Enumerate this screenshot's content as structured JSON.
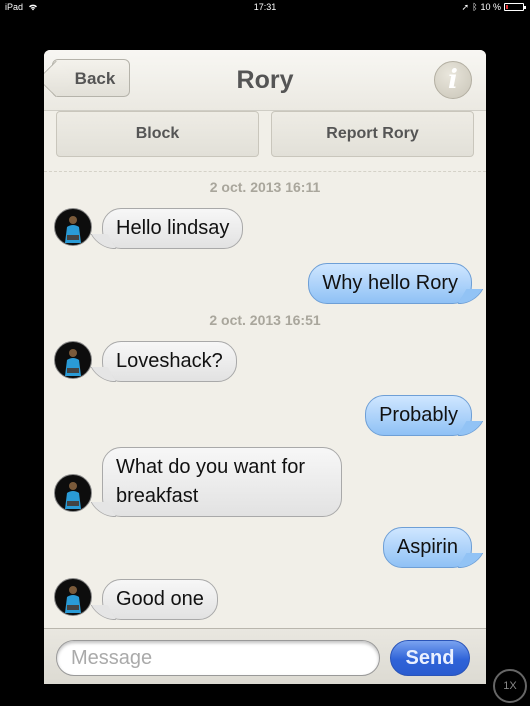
{
  "status_bar": {
    "device": "iPad",
    "wifi_icon": "wifi-icon",
    "time": "17:31",
    "battery_text": "10 %",
    "battery_level": 0.1,
    "battery_color": "#e33333"
  },
  "nav": {
    "back_label": "Back",
    "title": "Rory",
    "info_icon": "info-icon"
  },
  "actions": {
    "block_label": "Block",
    "report_label": "Report Rory"
  },
  "conversation": {
    "timestamp_1": "2 oct. 2013 16:11",
    "timestamp_2": "2 oct. 2013 16:51",
    "messages": [
      {
        "from": "Rory",
        "text": "Hello lindsay"
      },
      {
        "from": "me",
        "text": "Why hello Rory"
      },
      {
        "from": "Rory",
        "text": "Loveshack?"
      },
      {
        "from": "me",
        "text": "Probably"
      },
      {
        "from": "Rory",
        "text": "What do you want for breakfast"
      },
      {
        "from": "me",
        "text": "Aspirin"
      },
      {
        "from": "Rory",
        "text": "Good one"
      }
    ]
  },
  "composer": {
    "placeholder": "Message",
    "value": "",
    "send_label": "Send"
  },
  "zoom_label": "1X",
  "colors": {
    "outgoing_bubble": "#9cc8f7",
    "incoming_bubble": "#ececec",
    "send_button": "#2f63d8"
  }
}
